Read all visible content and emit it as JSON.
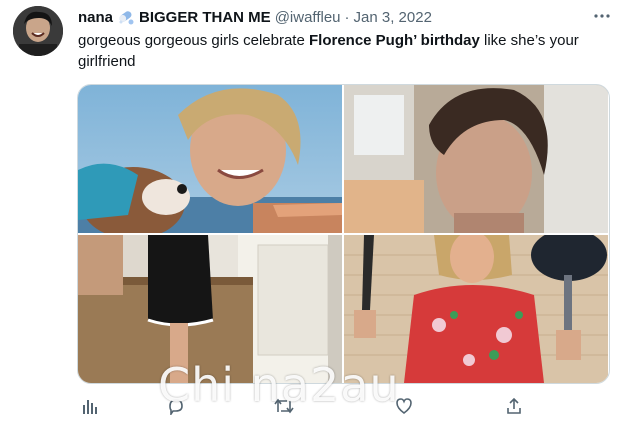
{
  "tweet": {
    "display_name": "nana",
    "name_emoji": "pill-emoji",
    "display_name_suffix": "BIGGER THAN ME",
    "handle": "@iwaffleu",
    "separator": "·",
    "date": "Jan 3, 2022",
    "text_before": "gorgeous gorgeous girls celebrate ",
    "text_bold": "Florence Pugh’ birthday",
    "text_after": " like she’s your girlfriend",
    "more_icon": "more-dots-icon"
  },
  "media": {
    "photos": [
      {
        "id": "beach-dog-photo"
      },
      {
        "id": "closeup-portrait-photo"
      },
      {
        "id": "black-dress-photo"
      },
      {
        "id": "knife-pan-photo"
      }
    ]
  },
  "actions": [
    {
      "icon": "analytics-icon"
    },
    {
      "icon": "reply-icon"
    },
    {
      "icon": "retweet-icon"
    },
    {
      "icon": "like-icon"
    },
    {
      "icon": "share-icon"
    }
  ],
  "watermark": "Chi na2au",
  "colors": {
    "text": "#0f1419",
    "secondary": "#536471",
    "border": "#cfd9de"
  }
}
